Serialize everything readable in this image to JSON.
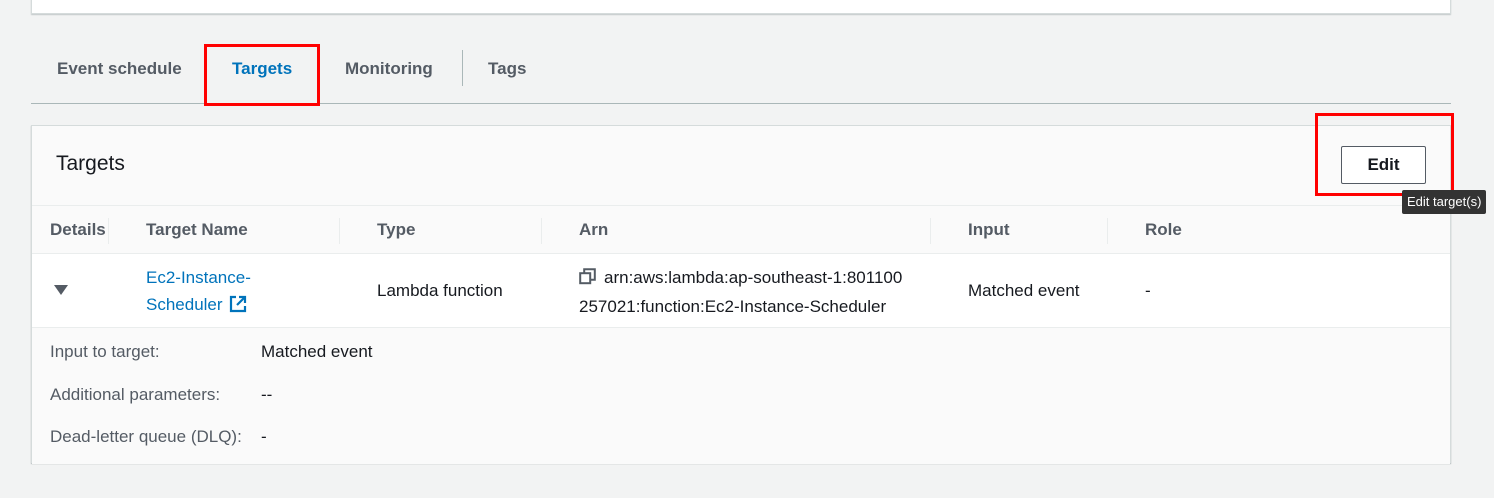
{
  "tabs": [
    {
      "label": "Event schedule",
      "active": false
    },
    {
      "label": "Targets",
      "active": true
    },
    {
      "label": "Monitoring",
      "active": false
    },
    {
      "label": "Tags",
      "active": false
    }
  ],
  "panel": {
    "title": "Targets",
    "edit_label": "Edit",
    "edit_tooltip": "Edit target(s)"
  },
  "table": {
    "columns": [
      "Details",
      "Target Name",
      "Type",
      "Arn",
      "Input",
      "Role"
    ],
    "rows": [
      {
        "name_line1": "Ec2-Instance-",
        "name_line2": "Scheduler",
        "type": "Lambda function",
        "arn_line1": "arn:aws:lambda:ap-southeast-1:801100",
        "arn_line2": "257021:function:Ec2-Instance-Scheduler",
        "input": "Matched event",
        "role": "-",
        "expanded": true
      }
    ]
  },
  "details": {
    "input_label": "Input to target:",
    "input_value": "Matched event",
    "params_label": "Additional parameters:",
    "params_value": "--",
    "dlq_label": "Dead-letter queue (DLQ):",
    "dlq_value": "-"
  },
  "colors": {
    "accent": "#0073bb",
    "highlight": "#ff0000",
    "background": "#f2f3f3"
  },
  "icons": {
    "expand": "caret-down-icon",
    "external": "external-link-icon",
    "copy": "copy-icon"
  }
}
